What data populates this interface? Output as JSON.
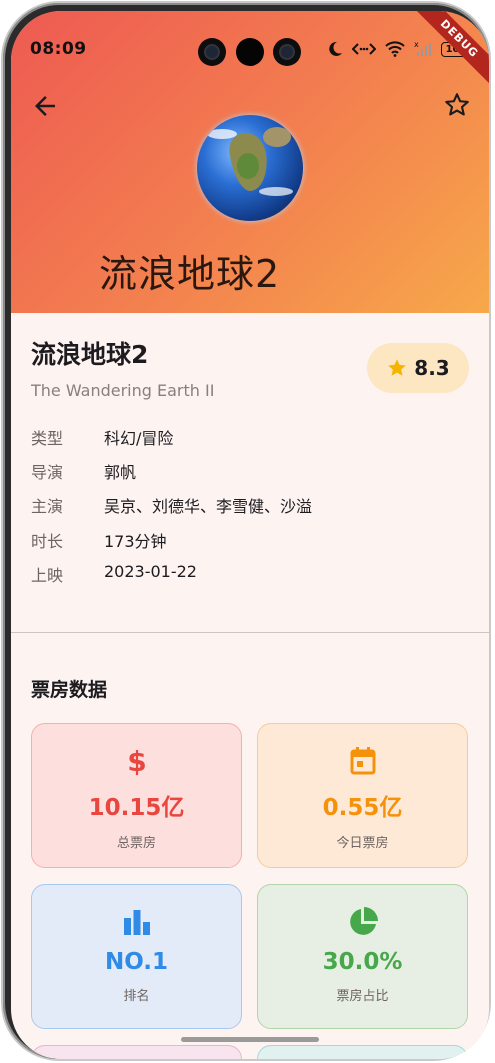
{
  "status_bar": {
    "time": "08:09",
    "battery": "100",
    "debug_label": "DEBUG"
  },
  "header": {
    "back_icon": "arrow-back-icon",
    "favorite_icon": "star-outline-icon",
    "poster": "earth-globe-image",
    "title": "流浪地球2",
    "gradient_colors": [
      "#ee5a52",
      "#f7a84a"
    ]
  },
  "movie": {
    "title": "流浪地球2",
    "english_title": "The Wandering Earth II",
    "rating": "8.3",
    "details": [
      {
        "key": "类型",
        "value": "科幻/冒险"
      },
      {
        "key": "导演",
        "value": "郭帆"
      },
      {
        "key": "主演",
        "value": "吴京、刘德华、李雪健、沙溢"
      },
      {
        "key": "时长",
        "value": "173分钟"
      },
      {
        "key": "上映",
        "value": "2023-01-22"
      }
    ]
  },
  "box_office": {
    "section_title": "票房数据",
    "cards": [
      {
        "icon": "dollar-icon",
        "value": "10.15亿",
        "label": "总票房",
        "color": "#e8463f"
      },
      {
        "icon": "calendar-today-icon",
        "value": "0.55亿",
        "label": "今日票房",
        "color": "#f5920c"
      },
      {
        "icon": "bar-chart-icon",
        "value": "NO.1",
        "label": "排名",
        "color": "#2f8be6"
      },
      {
        "icon": "pie-chart-icon",
        "value": "30.0%",
        "label": "票房占比",
        "color": "#46a84a"
      }
    ]
  }
}
